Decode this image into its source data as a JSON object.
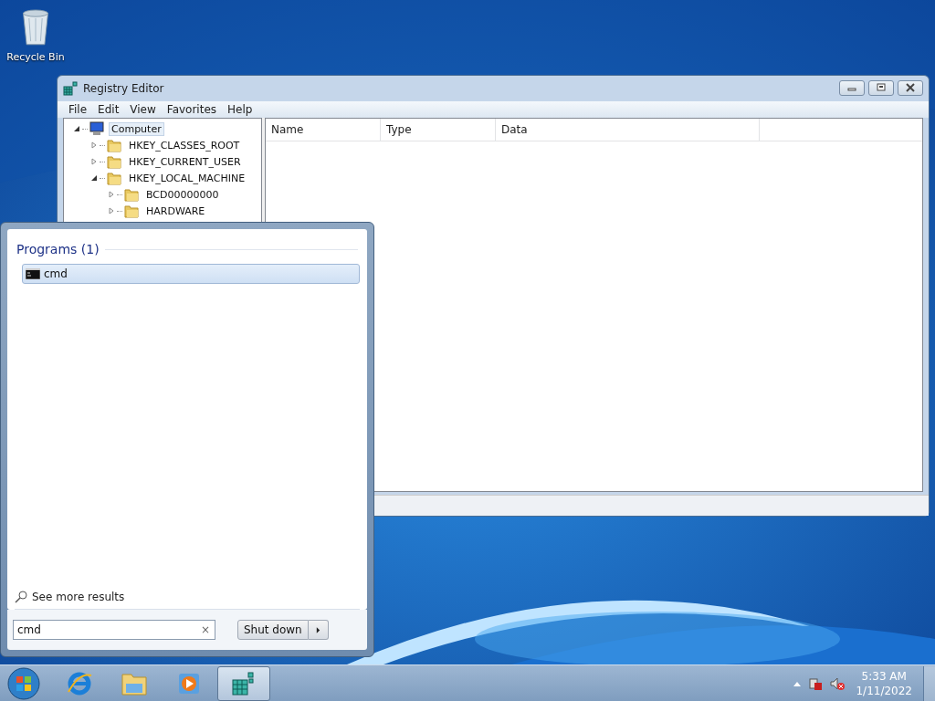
{
  "desktop": {
    "icons": [
      {
        "label": "Recycle Bin"
      }
    ]
  },
  "window": {
    "title": "Registry Editor",
    "menu": [
      "File",
      "Edit",
      "View",
      "Favorites",
      "Help"
    ],
    "tree": [
      {
        "label": "Computer",
        "kind": "computer",
        "expanded": true,
        "selected": true,
        "children": [
          {
            "label": "HKEY_CLASSES_ROOT",
            "kind": "folder",
            "expanded": false,
            "selected": false
          },
          {
            "label": "HKEY_CURRENT_USER",
            "kind": "folder",
            "expanded": false,
            "selected": false
          },
          {
            "label": "HKEY_LOCAL_MACHINE",
            "kind": "folder",
            "expanded": true,
            "selected": false,
            "children": [
              {
                "label": "BCD00000000",
                "kind": "folder",
                "expanded": false,
                "selected": false
              },
              {
                "label": "HARDWARE",
                "kind": "folder",
                "expanded": false,
                "selected": false
              }
            ]
          }
        ]
      }
    ],
    "columns": [
      "Name",
      "Type",
      "Data"
    ]
  },
  "start_menu": {
    "group": "Programs (1)",
    "results": [
      {
        "label": "cmd",
        "selected": true
      }
    ],
    "see_more": "See more results",
    "search": {
      "value": "cmd"
    },
    "clear": "×",
    "shutdown": "Shut down"
  },
  "taskbar": {
    "apps": [
      {
        "kind": "ie",
        "active": false
      },
      {
        "kind": "explorer",
        "active": false
      },
      {
        "kind": "media",
        "active": false
      },
      {
        "kind": "regedit",
        "active": true
      }
    ],
    "time": "5:33 AM",
    "date": "1/11/2022"
  }
}
